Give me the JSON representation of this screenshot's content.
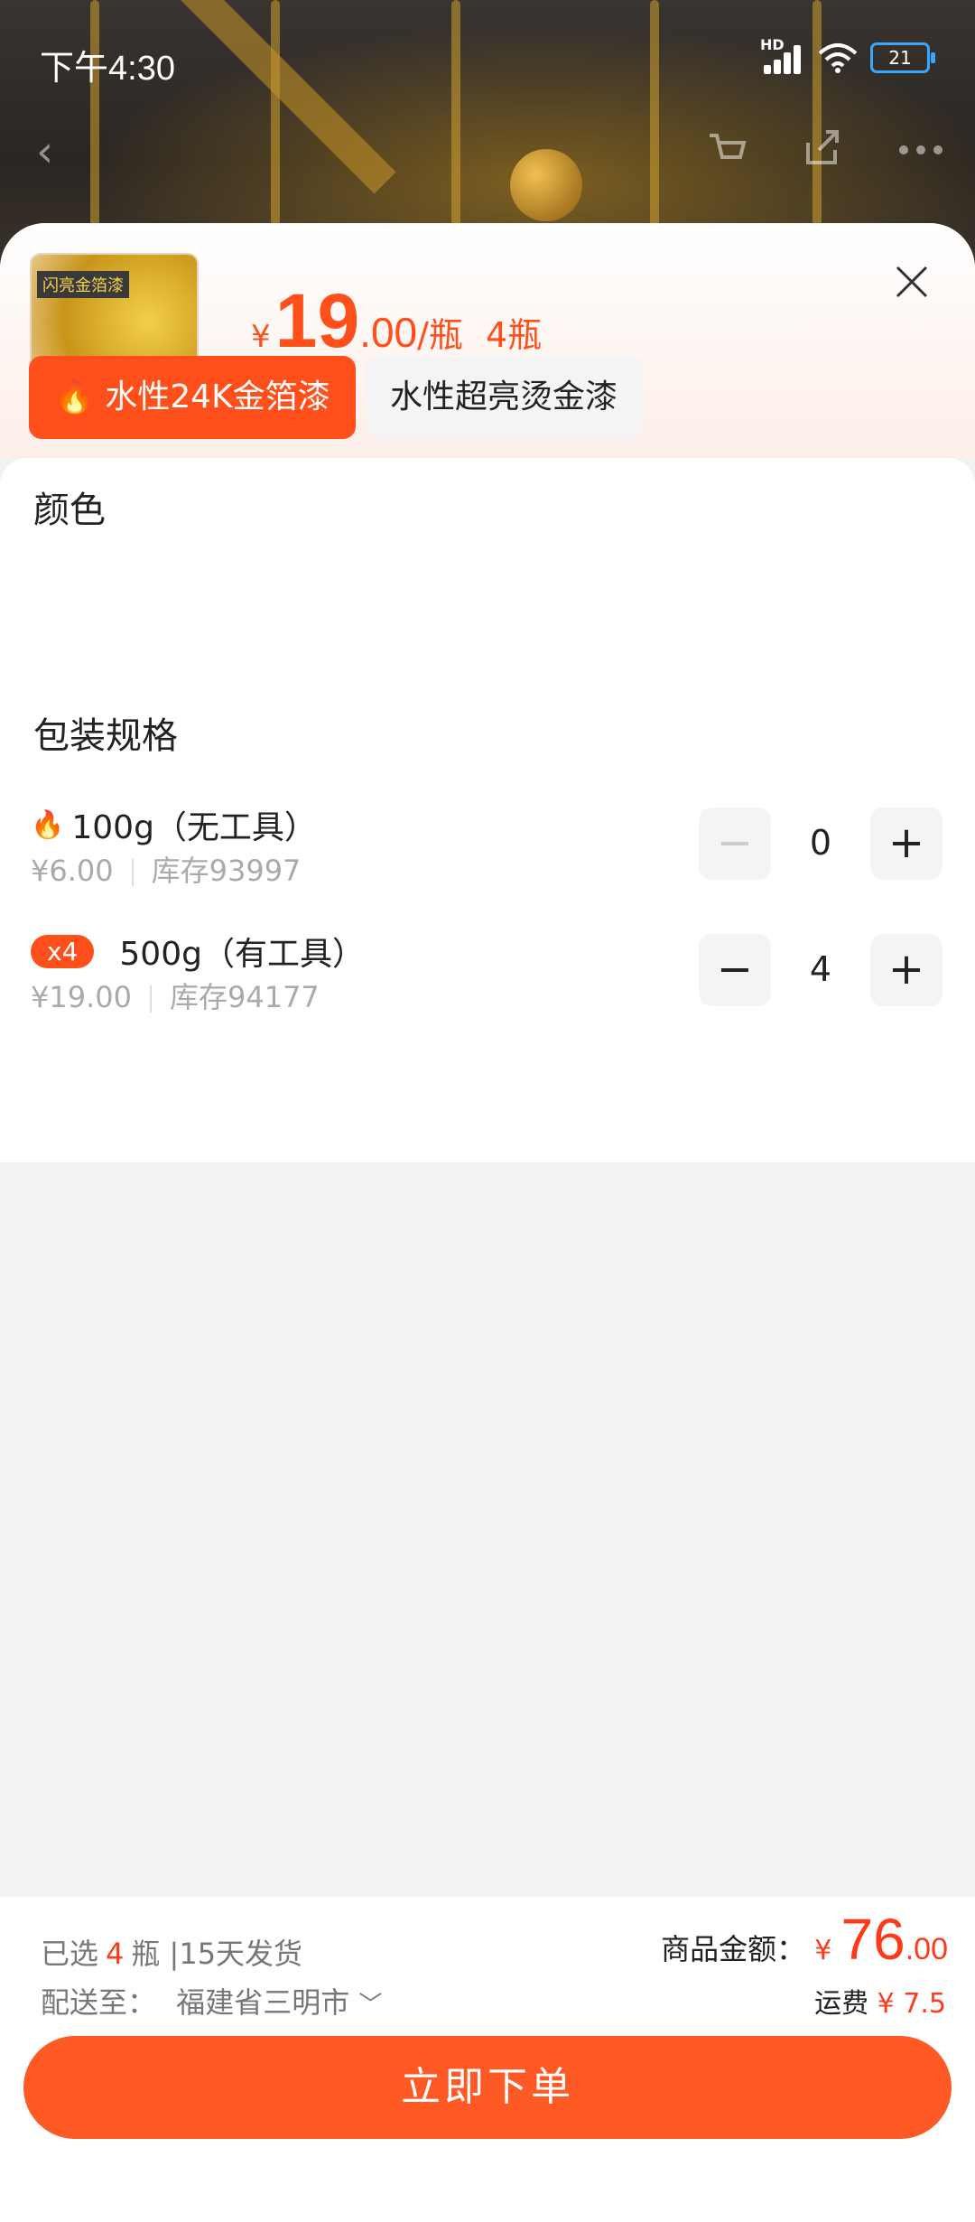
{
  "status_bar": {
    "time": "下午4:30",
    "battery": "21",
    "network": "HD"
  },
  "product": {
    "thumb_text": "闪亮金箔漆",
    "price_currency": "¥",
    "price_int": "19",
    "price_dec": ".00",
    "price_unit": "/瓶",
    "selected_qty": "4瓶"
  },
  "color_section": {
    "title": "颜色",
    "options": [
      {
        "label": "水性24K金箔漆",
        "selected": true
      },
      {
        "label": "水性超亮烫金漆",
        "selected": false
      }
    ]
  },
  "spec_section": {
    "title": "包装规格",
    "items": [
      {
        "name": "100g（无工具）",
        "price": "¥6.00",
        "stock": "库存93997",
        "qty": "0",
        "badge": ""
      },
      {
        "name": "500g（有工具）",
        "price": "¥19.00",
        "stock": "库存94177",
        "qty": "4",
        "badge": "x4"
      }
    ]
  },
  "bottom_bar": {
    "selected_prefix": "已选",
    "selected_count": "4",
    "selected_suffix": "瓶 |15天发货",
    "delivery_label": "配送至：",
    "delivery_location": "福建省三明市",
    "amount_label": "商品金额：",
    "amount_currency": "¥",
    "amount_int": "76",
    "amount_dec": ".00",
    "shipping_label": "运费",
    "shipping_value": "¥ 7.5",
    "order_button": "立即下单"
  },
  "colors": {
    "accent": "#ff4f1a",
    "button": "#ff5a26"
  }
}
